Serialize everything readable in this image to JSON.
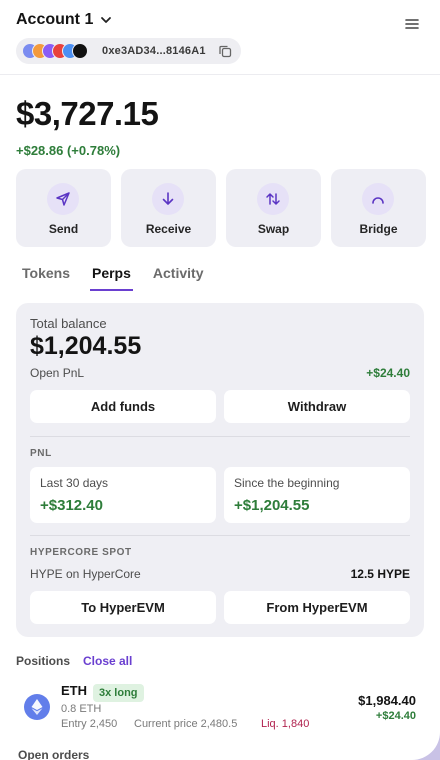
{
  "header": {
    "account_name": "Account 1",
    "address": "0xe3AD34...8146A1"
  },
  "portfolio": {
    "balance": "$3,727.15",
    "change": "+$28.86 (+0.78%)"
  },
  "actions": [
    {
      "label": "Send",
      "icon": "send-icon"
    },
    {
      "label": "Receive",
      "icon": "arrow-down-icon"
    },
    {
      "label": "Swap",
      "icon": "swap-icon"
    },
    {
      "label": "Bridge",
      "icon": "bridge-icon"
    }
  ],
  "tabs": [
    {
      "label": "Tokens",
      "active": false
    },
    {
      "label": "Perps",
      "active": true
    },
    {
      "label": "Activity",
      "active": false
    }
  ],
  "perps": {
    "total_balance_label": "Total balance",
    "total_balance": "$1,204.55",
    "open_pnl_label": "Open PnL",
    "open_pnl": "+$24.40",
    "add_funds": "Add funds",
    "withdraw": "Withdraw",
    "pnl_section": "PNL",
    "last30_label": "Last 30 days",
    "last30_value": "+$312.40",
    "since_label": "Since the beginning",
    "since_value": "+$1,204.55",
    "spot_section": "HYPERCORE SPOT",
    "spot_label": "HYPE on HyperCore",
    "spot_value": "12.5 HYPE",
    "to_evm": "To HyperEVM",
    "from_evm": "From HyperEVM"
  },
  "positions": {
    "heading": "Positions",
    "close_all": "Close all",
    "items": [
      {
        "asset": "ETH",
        "leverage": "3x long",
        "size": "0.8 ETH",
        "entry": "Entry 2,450",
        "current": "Current price 2,480.5",
        "liq": "Liq. 1,840",
        "value": "$1,984.40",
        "pnl": "+$24.40"
      }
    ]
  },
  "open_orders_heading": "Open orders",
  "colors": {
    "accent": "#6a3fd0",
    "positive": "#2e7d3a",
    "negative": "#b0224e"
  }
}
